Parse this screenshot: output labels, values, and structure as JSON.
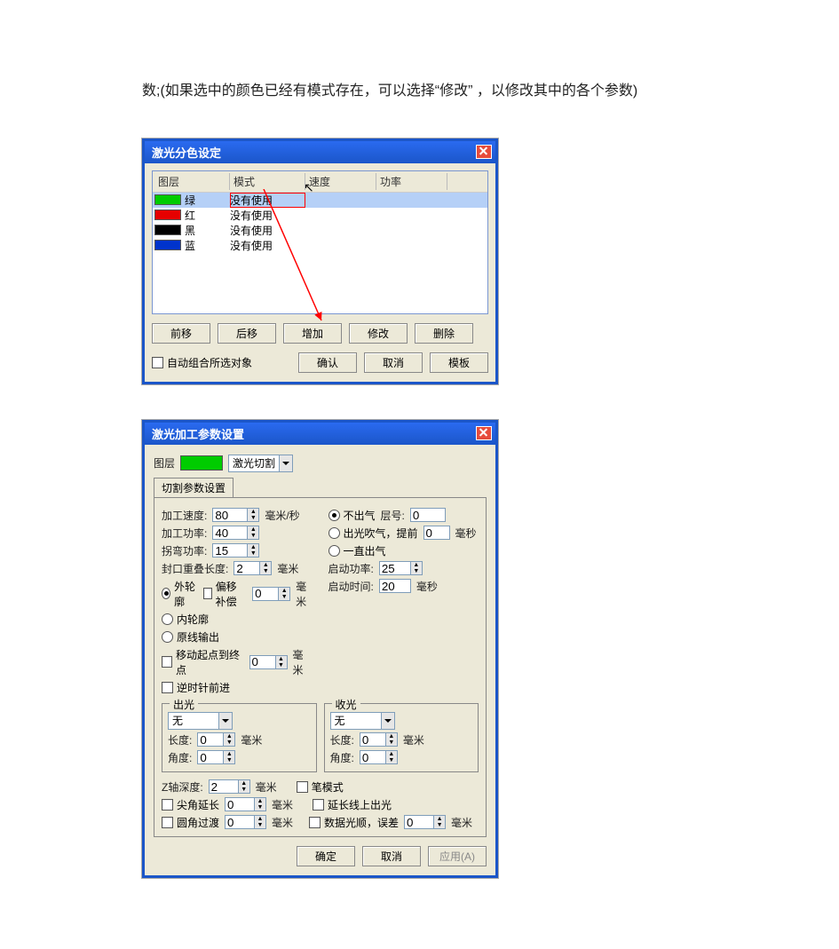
{
  "intro": "数;(如果选中的颜色已经有模式存在，可以选择“修改” ，以修改其中的各个参数)",
  "dialog1": {
    "title": "激光分色设定",
    "headers": {
      "layer": "图层",
      "mode": "模式",
      "speed": "速度",
      "power": "功率"
    },
    "rows": [
      {
        "color": "#00cc00",
        "name": "绿",
        "mode": "没有使用",
        "selected": true
      },
      {
        "color": "#e60000",
        "name": "红",
        "mode": "没有使用"
      },
      {
        "color": "#000000",
        "name": "黑",
        "mode": "没有使用"
      },
      {
        "color": "#0033cc",
        "name": "蓝",
        "mode": "没有使用"
      }
    ],
    "buttons": {
      "fwd": "前移",
      "back": "后移",
      "add": "增加",
      "edit": "修改",
      "del": "删除",
      "ok": "确认",
      "cancel": "取消",
      "template": "模板"
    },
    "checkbox_auto_group": "自动组合所选对象"
  },
  "dialog2": {
    "title": "激光加工参数设置",
    "layer_label": "图层",
    "layer_color": "#00cc00",
    "mode_options_selected": "激光切割",
    "tab_label": "切割参数设置",
    "left": {
      "speed_label": "加工速度:",
      "speed_value": "80",
      "speed_unit": "毫米/秒",
      "power_label": "加工功率:",
      "power_value": "40",
      "corner_label": "拐弯功率:",
      "corner_value": "15",
      "seal_label": "封口重叠长度:",
      "seal_value": "2",
      "seal_unit": "毫米",
      "contour_outer": "外轮廓",
      "offset_comp_label": "偏移补偿",
      "offset_comp_value": "0",
      "offset_comp_unit": "毫米",
      "contour_inner": "内轮廓",
      "orig_output": "原线输出",
      "move_start_label": "移动起点到终点",
      "move_start_value": "0",
      "move_start_unit": "毫米",
      "ccw_label": "逆时针前进"
    },
    "right": {
      "noair": "不出气",
      "layer_num_label": "层号:",
      "layer_num_value": "0",
      "air_advance_label": "出光吹气，提前",
      "air_advance_value": "0",
      "air_advance_unit": "毫秒",
      "always_air": "一直出气",
      "start_power_label": "启动功率:",
      "start_power_value": "25",
      "start_time_label": "启动时间:",
      "start_time_value": "20",
      "start_time_unit": "毫秒"
    },
    "group_out": {
      "title": "出光",
      "dropdown": "无",
      "len_label": "长度:",
      "len_value": "0",
      "len_unit": "毫米",
      "ang_label": "角度:",
      "ang_value": "0"
    },
    "group_in": {
      "title": "收光",
      "dropdown": "无",
      "len_label": "长度:",
      "len_value": "0",
      "len_unit": "毫米",
      "ang_label": "角度:",
      "ang_value": "0"
    },
    "bottom": {
      "zdepth_label": "Z轴深度:",
      "zdepth_value": "2",
      "zdepth_unit": "毫米",
      "pen_mode": "笔模式",
      "sharp_ext_label": "尖角延长",
      "sharp_ext_value": "0",
      "sharp_ext_unit": "毫米",
      "ext_line_light": "延长线上出光",
      "arc_trans_label": "圆角过渡",
      "arc_trans_value": "0",
      "arc_trans_unit": "毫米",
      "smooth_label": "数据光顺，误差",
      "smooth_value": "0",
      "smooth_unit": "毫米"
    },
    "footer": {
      "ok": "确定",
      "cancel": "取消",
      "apply": "应用(A)"
    }
  }
}
